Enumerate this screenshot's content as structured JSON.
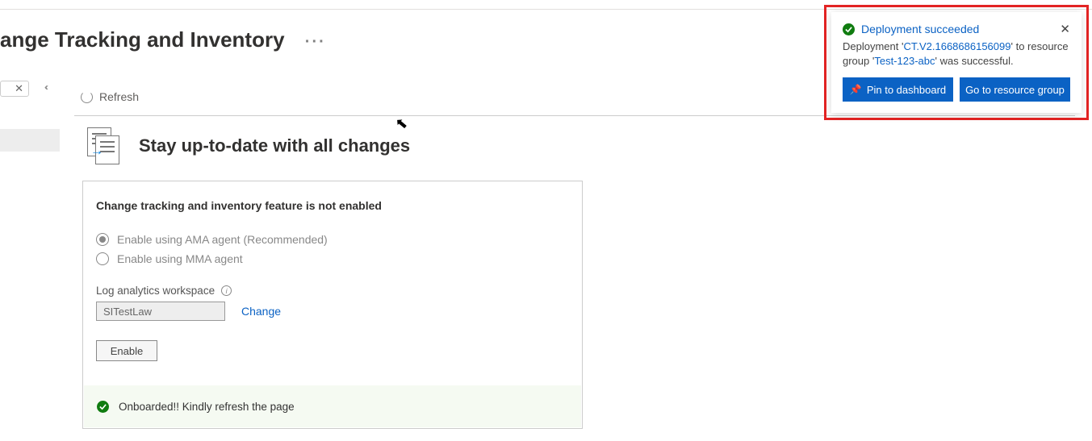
{
  "header": {
    "title": "ange Tracking and Inventory",
    "ellipsis": "··· "
  },
  "toolbar": {
    "refresh_label": "Refresh"
  },
  "hero": {
    "heading": "Stay up-to-date with all changes"
  },
  "card": {
    "title": "Change tracking and inventory feature is not enabled",
    "options": {
      "ama": "Enable using AMA agent (Recommended)",
      "mma": "Enable using MMA agent"
    },
    "workspace_label": "Log analytics workspace",
    "workspace_value": "SITestLaw",
    "change_label": "Change",
    "enable_label": "Enable",
    "status_text": "Onboarded!! Kindly refresh the page"
  },
  "toast": {
    "title": "Deployment succeeded",
    "body_prefix": "Deployment '",
    "deployment_name": "CT.V2.1668686156099",
    "body_mid": "' to resource group '",
    "resource_group": "Test-123-abc",
    "body_suffix": "' was successful.",
    "pin_label": "Pin to dashboard",
    "goto_label": "Go to resource group"
  }
}
